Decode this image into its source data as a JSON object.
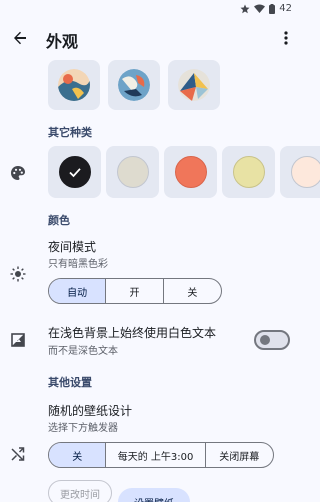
{
  "status_bar": {
    "battery": "42"
  },
  "app_bar": {
    "title": "外观"
  },
  "wallpapers": [
    {
      "name": "wallpaper-1"
    },
    {
      "name": "wallpaper-2"
    },
    {
      "name": "wallpaper-3"
    }
  ],
  "sections": {
    "other_types": "其它种类",
    "color": "颜色",
    "other_settings": "其他设置"
  },
  "colors": {
    "accent": "#d8e2ff",
    "swatches": [
      {
        "hex": "#1b1b1f",
        "selected": true
      },
      {
        "hex": "#dedbcf",
        "selected": false
      },
      {
        "hex": "#f0765a",
        "selected": false
      },
      {
        "hex": "#e8e2a4",
        "selected": false
      },
      {
        "hex": "#fde8dc",
        "selected": false
      }
    ]
  },
  "night_mode": {
    "title": "夜间模式",
    "subtitle": "只有暗黑色彩",
    "options": [
      "自动",
      "开",
      "关"
    ],
    "selected_index": 0
  },
  "white_text": {
    "title": "在浅色背景上始终使用白色文本",
    "subtitle": "而不是深色文本",
    "enabled": false
  },
  "random_wallpaper": {
    "title": "随机的壁纸设计",
    "subtitle": "选择下方触发器",
    "options": [
      "关",
      "每天的 上午3:00",
      "关闭屏幕"
    ],
    "selected_index": 0
  },
  "buttons": {
    "change_time": "更改时间",
    "set_wallpaper": "设置壁纸"
  }
}
